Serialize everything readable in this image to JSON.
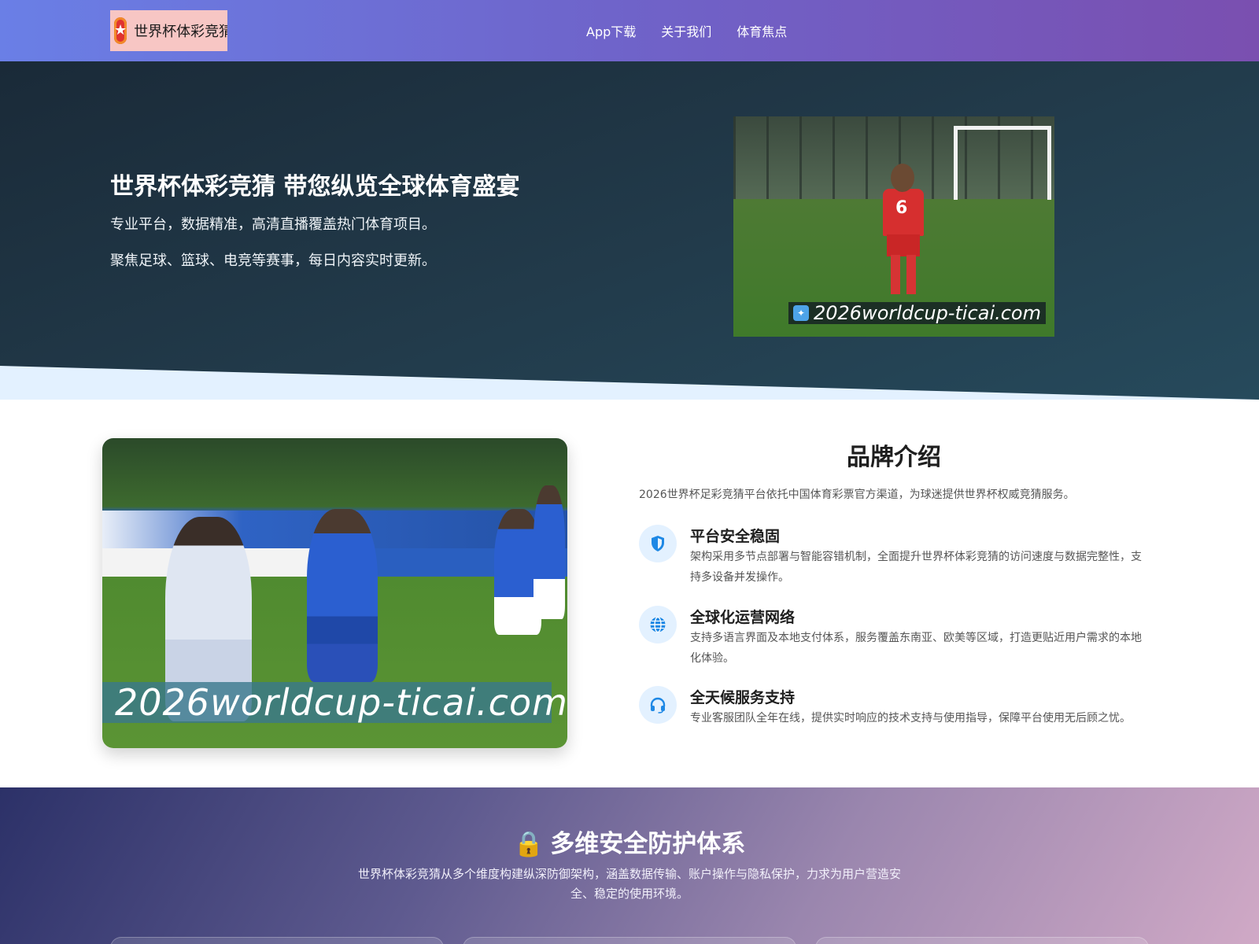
{
  "header": {
    "logo_text": "世界杯体彩竞猜",
    "logo_icon": "star-badge-icon",
    "nav": [
      {
        "label": "App下载"
      },
      {
        "label": "关于我们"
      },
      {
        "label": "体育焦点"
      }
    ]
  },
  "hero": {
    "title": "世界杯体彩竞猜 带您纵览全球体育盛宴",
    "subtitle1": "专业平台，数据精准，高清直播覆盖热门体育项目。",
    "subtitle2": "聚焦足球、篮球、电竞等赛事，每日内容实时更新。",
    "image_watermark": "2026worldcup-ticai.com",
    "jersey_number": "6"
  },
  "brand": {
    "title": "品牌介绍",
    "intro": "2026世界杯足彩竞猜平台依托中国体育彩票官方渠道，为球迷提供世界杯权威竞猜服务。",
    "image_watermark": "2026worldcup-ticai.com",
    "features": [
      {
        "icon": "shield-icon",
        "title": "平台安全稳固",
        "desc": "架构采用多节点部署与智能容错机制，全面提升世界杯体彩竞猜的访问速度与数据完整性，支持多设备并发操作。"
      },
      {
        "icon": "globe-icon",
        "title": "全球化运营网络",
        "desc": "支持多语言界面及本地支付体系，服务覆盖东南亚、欧美等区域，打造更贴近用户需求的本地化体验。"
      },
      {
        "icon": "headset-icon",
        "title": "全天候服务支持",
        "desc": "专业客服团队全年在线，提供实时响应的技术支持与使用指导，保障平台使用无后顾之忧。"
      }
    ]
  },
  "security": {
    "icon": "lock-icon",
    "title": "多维安全防护体系",
    "desc": "世界杯体彩竞猜从多个维度构建纵深防御架构，涵盖数据传输、账户操作与隐私保护，力求为用户营造安全、稳定的使用环境。"
  },
  "colors": {
    "header_start": "#6a7fe6",
    "header_end": "#7a4fb0",
    "hero_bg": "#223b4b",
    "accent_blue": "#1e88e5",
    "lock": "#f5b82e"
  }
}
